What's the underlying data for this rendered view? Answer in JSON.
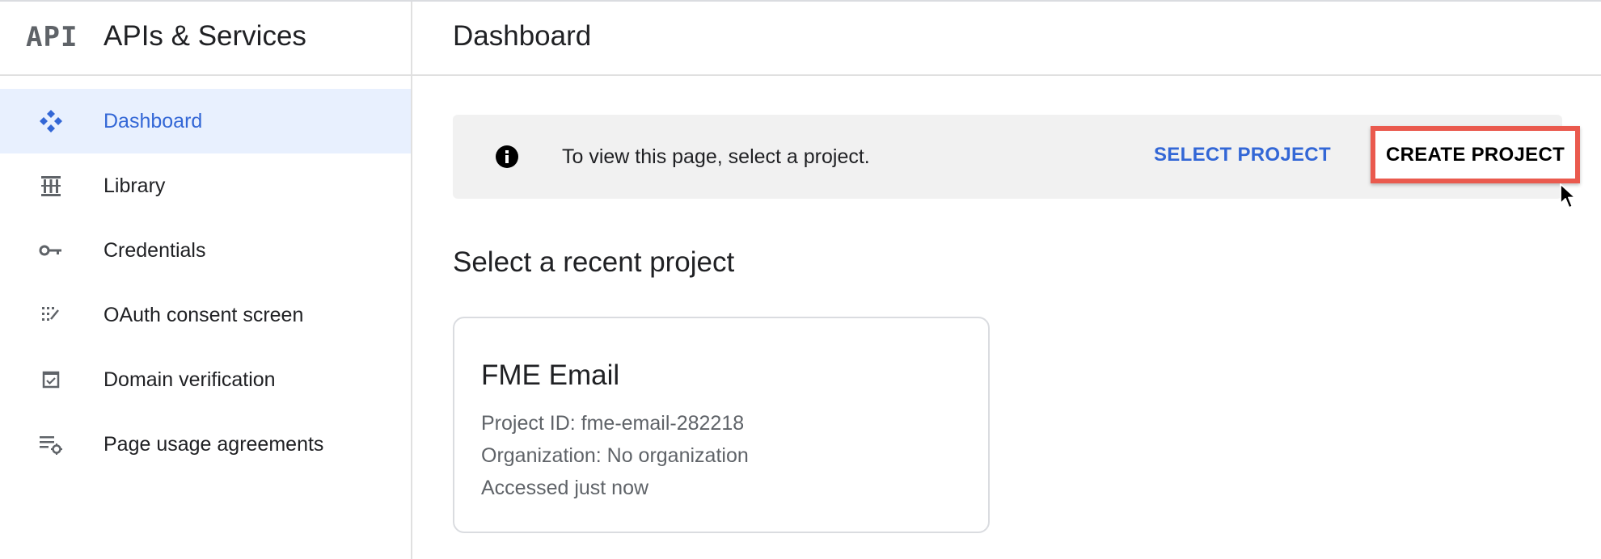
{
  "sidebar": {
    "logo": "API",
    "title": "APIs & Services",
    "items": [
      {
        "label": "Dashboard",
        "icon": "dashboard-diamond-icon",
        "active": true
      },
      {
        "label": "Library",
        "icon": "library-icon",
        "active": false
      },
      {
        "label": "Credentials",
        "icon": "key-icon",
        "active": false
      },
      {
        "label": "OAuth consent screen",
        "icon": "oauth-consent-icon",
        "active": false
      },
      {
        "label": "Domain verification",
        "icon": "checkbox-icon",
        "active": false
      },
      {
        "label": "Page usage agreements",
        "icon": "list-settings-icon",
        "active": false
      }
    ]
  },
  "main": {
    "title": "Dashboard",
    "banner": {
      "icon": "info-icon",
      "text": "To view this page, select a project.",
      "select_label": "SELECT PROJECT",
      "create_label": "CREATE PROJECT"
    },
    "recent": {
      "title": "Select a recent project",
      "projects": [
        {
          "name": "FME Email",
          "id_line": "Project ID: fme-email-282218",
          "org_line": "Organization: No organization",
          "accessed_line": "Accessed just now"
        }
      ]
    }
  },
  "colors": {
    "accent_blue": "#3367d6",
    "active_bg": "#e8f0fe",
    "highlight_red": "#ea5a4e",
    "banner_bg": "#f1f1f1"
  }
}
